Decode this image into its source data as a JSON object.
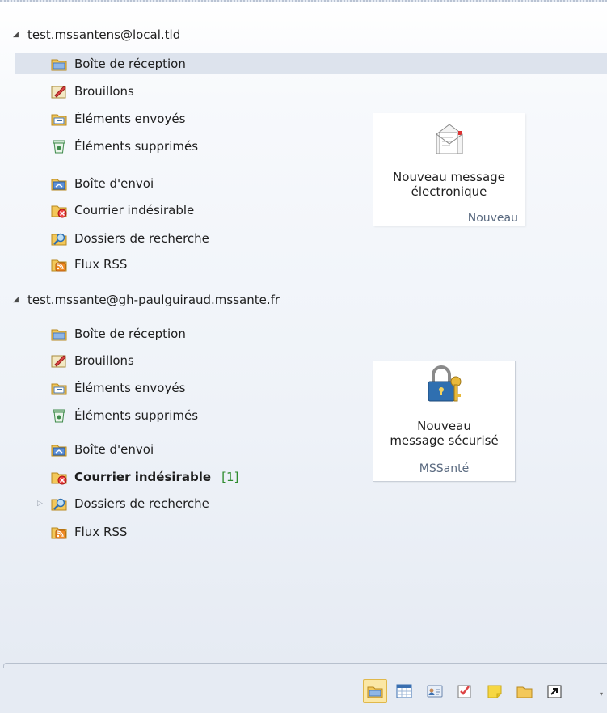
{
  "accounts": [
    {
      "email": "test.mssantens@local.tld",
      "folders": [
        {
          "label": "Boîte de réception",
          "icon": "inbox-icon"
        },
        {
          "label": "Brouillons",
          "icon": "drafts-icon"
        },
        {
          "label": "Éléments envoyés",
          "icon": "sent-items-icon"
        },
        {
          "label": "Éléments supprimés",
          "icon": "deleted-items-icon"
        },
        {
          "label": "Boîte d'envoi",
          "icon": "outbox-icon"
        },
        {
          "label": "Courrier indésirable",
          "icon": "junk-mail-icon"
        },
        {
          "label": "Dossiers de recherche",
          "icon": "search-folders-icon"
        },
        {
          "label": "Flux RSS",
          "icon": "rss-feeds-icon"
        }
      ]
    },
    {
      "email": "test.mssante@gh-paulguiraud.mssante.fr",
      "folders": [
        {
          "label": "Boîte de réception",
          "icon": "inbox-icon"
        },
        {
          "label": "Brouillons",
          "icon": "drafts-icon"
        },
        {
          "label": "Éléments envoyés",
          "icon": "sent-items-icon"
        },
        {
          "label": "Éléments supprimés",
          "icon": "deleted-items-icon"
        },
        {
          "label": "Boîte d'envoi",
          "icon": "outbox-icon"
        },
        {
          "label": "Courrier indésirable",
          "icon": "junk-mail-icon",
          "count": "[1]"
        },
        {
          "label": "Dossiers de recherche",
          "icon": "search-folders-icon"
        },
        {
          "label": "Flux RSS",
          "icon": "rss-feeds-icon"
        }
      ]
    }
  ],
  "ribbon": {
    "new_group": {
      "button_line1": "Nouveau message",
      "button_line2": "électronique",
      "group_label": "Nouveau",
      "icon": "new-email-icon"
    },
    "mssante_group": {
      "button_line1": "Nouveau",
      "button_line2": "message sécurisé",
      "group_label": "MSSanté",
      "icon": "padlock-key-icon"
    }
  },
  "navigation": [
    {
      "icon": "mail-icon",
      "active": true
    },
    {
      "icon": "calendar-icon"
    },
    {
      "icon": "contacts-icon"
    },
    {
      "icon": "tasks-icon"
    },
    {
      "icon": "notes-icon"
    },
    {
      "icon": "folder-list-icon"
    },
    {
      "icon": "shortcuts-icon"
    }
  ],
  "colors": {
    "selection": "#dde3ed",
    "unread_count": "#2e8b2e",
    "nav_active": "#fbe7a5"
  }
}
